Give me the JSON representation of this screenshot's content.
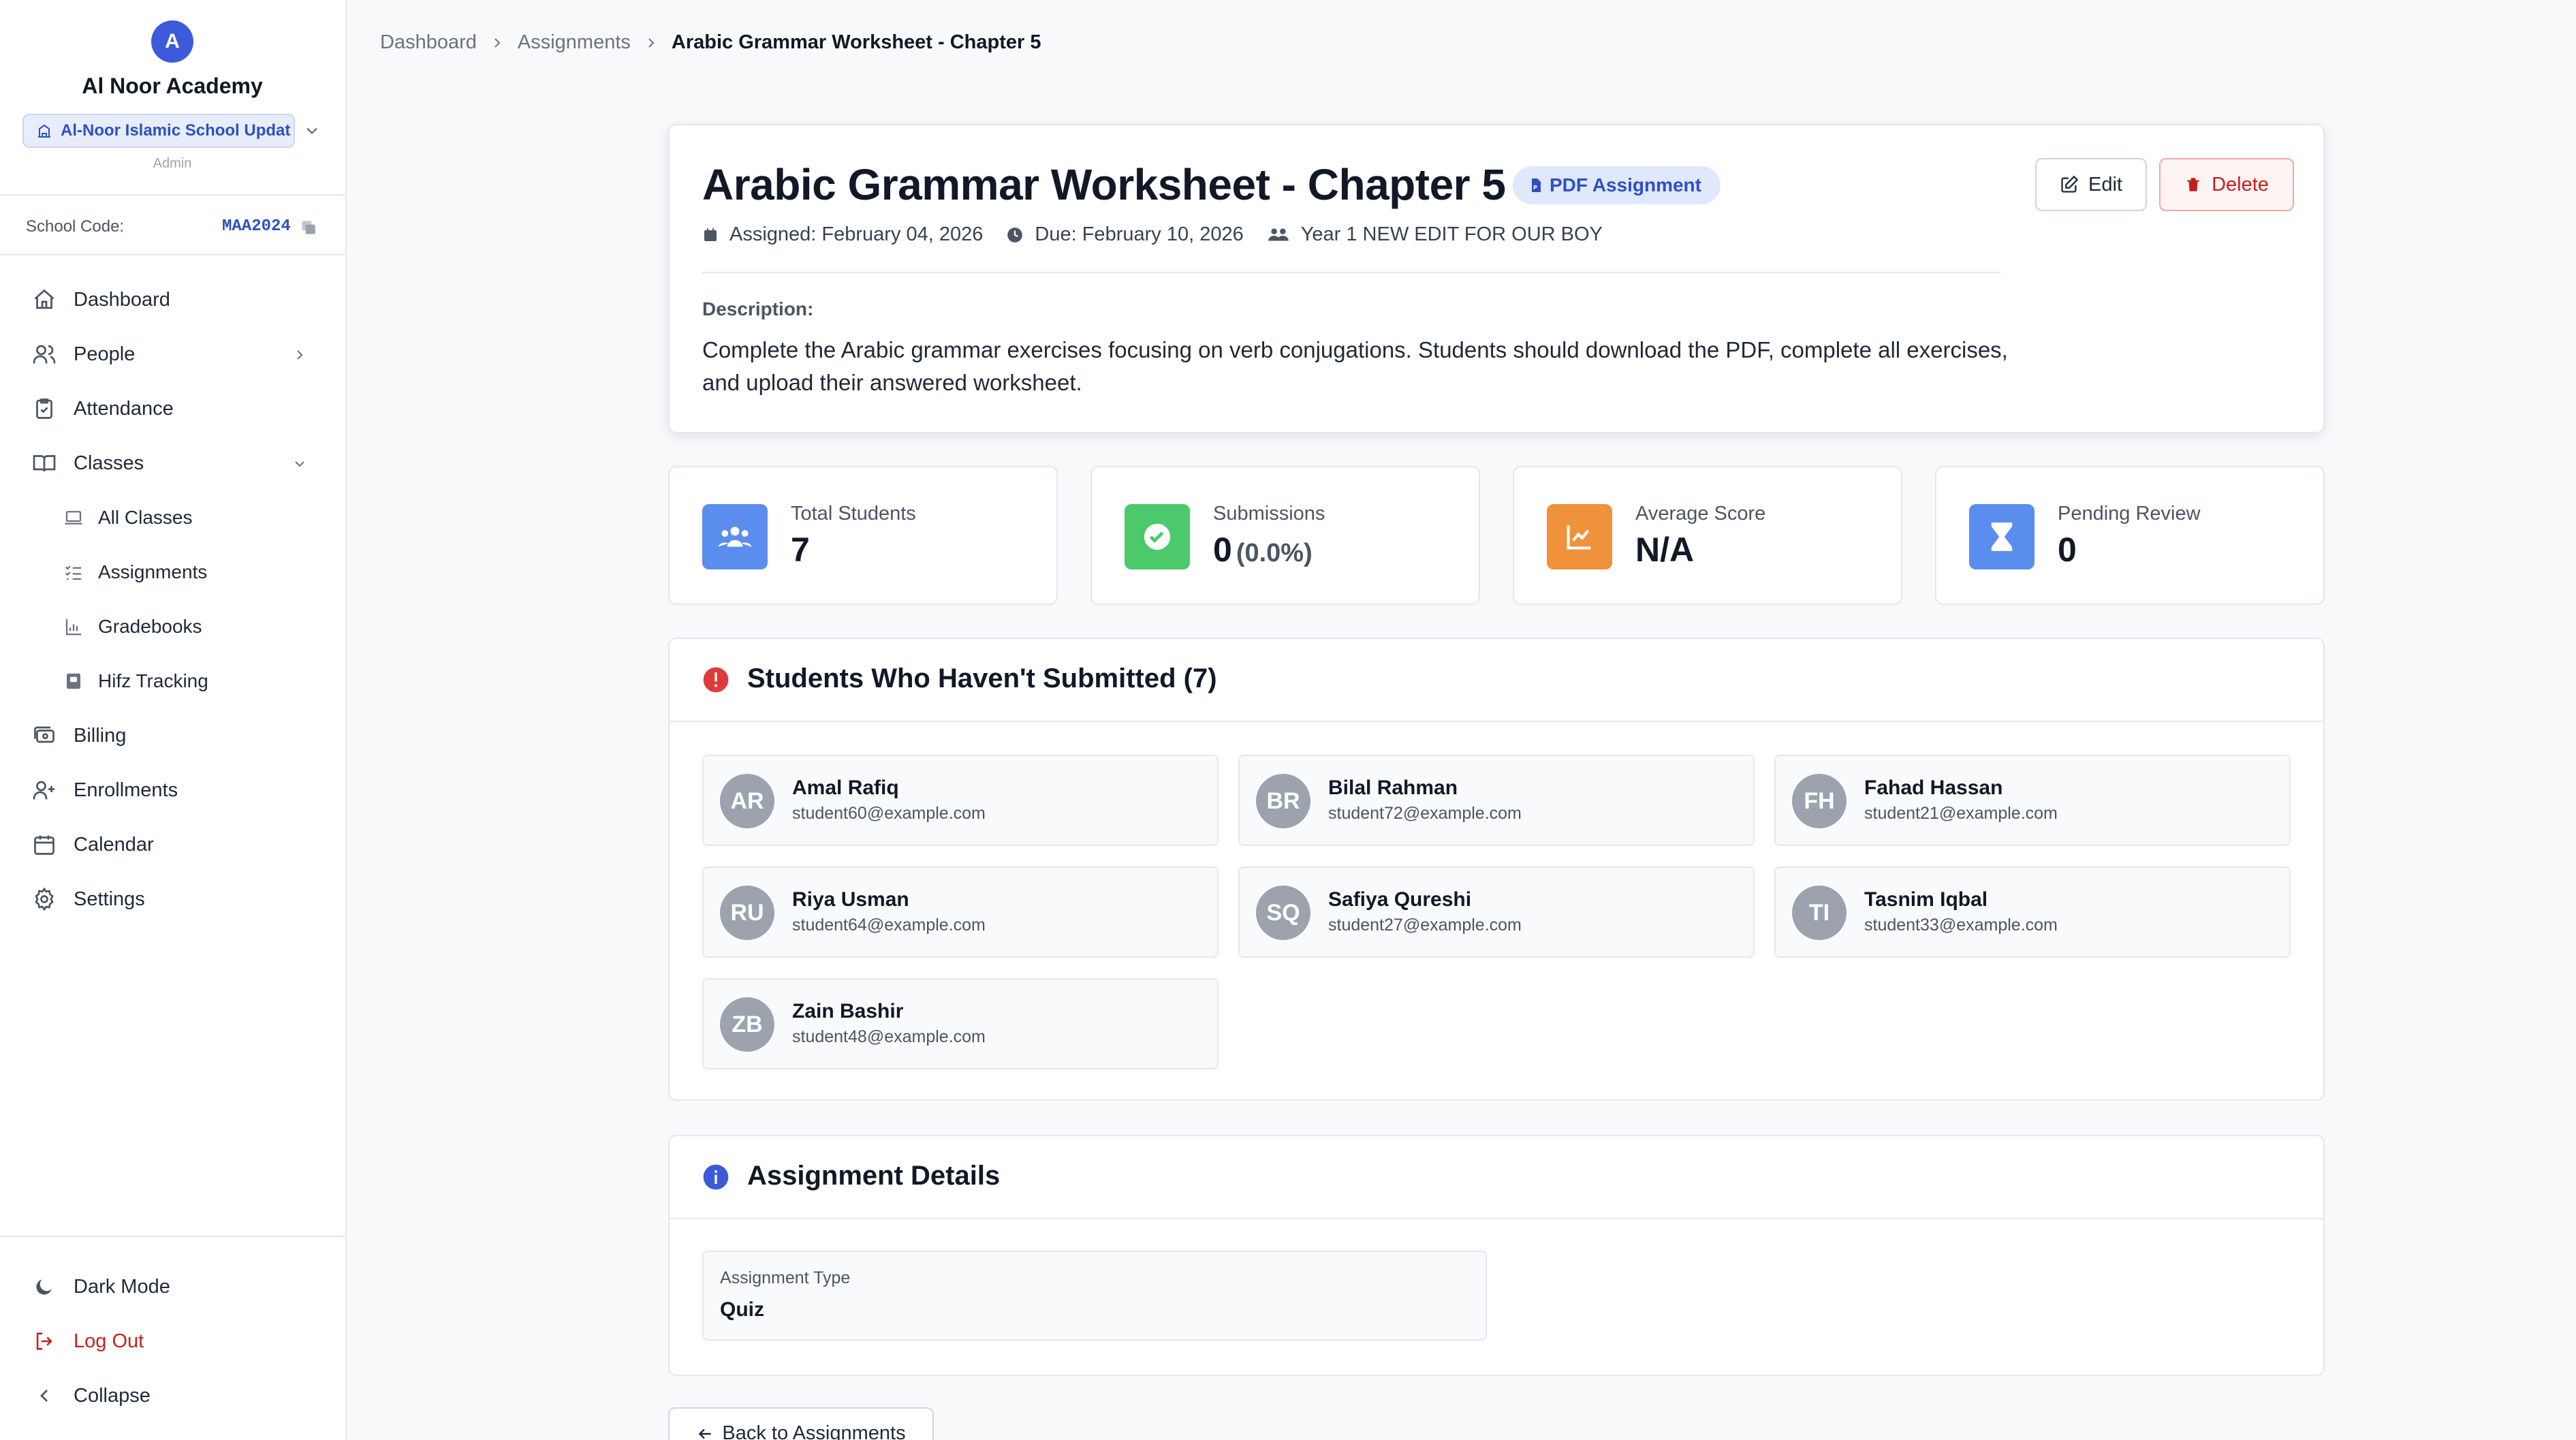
{
  "sidebar": {
    "avatar_letter": "A",
    "academy_name": "Al Noor Academy",
    "school_selector": "Al-Noor Islamic School Updat",
    "role": "Admin",
    "school_code_label": "School Code:",
    "school_code": "MAA2024",
    "nav": {
      "dashboard": "Dashboard",
      "people": "People",
      "attendance": "Attendance",
      "classes": "Classes",
      "all_classes": "All Classes",
      "assignments": "Assignments",
      "gradebooks": "Gradebooks",
      "hifz": "Hifz Tracking",
      "billing": "Billing",
      "enrollments": "Enrollments",
      "calendar": "Calendar",
      "settings": "Settings"
    },
    "bottom": {
      "dark_mode": "Dark Mode",
      "logout": "Log Out",
      "collapse": "Collapse"
    }
  },
  "breadcrumb": [
    "Dashboard",
    "Assignments",
    "Arabic Grammar Worksheet - Chapter 5"
  ],
  "assignment": {
    "title": "Arabic Grammar Worksheet - Chapter 5",
    "type_badge": "PDF Assignment",
    "edit_label": "Edit",
    "delete_label": "Delete",
    "assigned": "Assigned: February 04, 2026",
    "due": "Due: February 10, 2026",
    "class_name": "Year 1 NEW EDIT FOR OUR BOY",
    "description_label": "Description:",
    "description": "Complete the Arabic grammar exercises focusing on verb conjugations. Students should download the PDF, complete all exercises, and upload their answered worksheet."
  },
  "stats": {
    "total_students": {
      "label": "Total Students",
      "value": "7"
    },
    "submissions": {
      "label": "Submissions",
      "value": "0",
      "extra": "(0.0%)"
    },
    "average_score": {
      "label": "Average Score",
      "value": "N/A"
    },
    "pending_review": {
      "label": "Pending Review",
      "value": "0"
    }
  },
  "not_submitted": {
    "title": "Students Who Haven't Submitted (7)",
    "students": [
      {
        "initials": "AR",
        "name": "Amal Rafiq",
        "email": "student60@example.com"
      },
      {
        "initials": "BR",
        "name": "Bilal Rahman",
        "email": "student72@example.com"
      },
      {
        "initials": "FH",
        "name": "Fahad Hassan",
        "email": "student21@example.com"
      },
      {
        "initials": "RU",
        "name": "Riya Usman",
        "email": "student64@example.com"
      },
      {
        "initials": "SQ",
        "name": "Safiya Qureshi",
        "email": "student27@example.com"
      },
      {
        "initials": "TI",
        "name": "Tasnim Iqbal",
        "email": "student33@example.com"
      },
      {
        "initials": "ZB",
        "name": "Zain Bashir",
        "email": "student48@example.com"
      }
    ]
  },
  "details": {
    "title": "Assignment Details",
    "type_label": "Assignment Type",
    "type_value": "Quiz"
  },
  "back_label": "Back to Assignments",
  "colors": {
    "brand": "#3b5bdb",
    "stat_students": "#5b8def",
    "stat_submissions": "#4cc96b",
    "stat_score": "#f0913b",
    "stat_pending": "#5b8def",
    "alert": "#e03b3b",
    "danger": "#c81e1e"
  }
}
